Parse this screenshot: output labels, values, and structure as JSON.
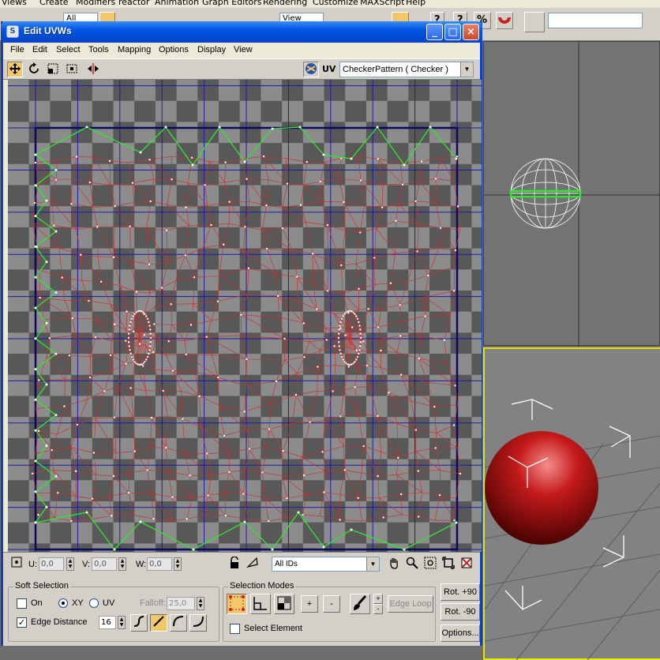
{
  "host": {
    "menu": [
      "Views",
      "Create",
      "Modifiers",
      "reactor",
      "Animation",
      "Graph Editors",
      "Rendering",
      "Customize",
      "MAXScript",
      "Help"
    ],
    "selection_set_value": "All",
    "view_value": "View"
  },
  "window": {
    "title": "Edit UVWs",
    "icon_glyph": "S",
    "controls": [
      "_",
      "□",
      "×"
    ]
  },
  "menubar": [
    "File",
    "Edit",
    "Select",
    "Tools",
    "Mapping",
    "Options",
    "Display",
    "View"
  ],
  "toolbar": {
    "uv_label": "UV",
    "texture_value": "CheckerPattern  ( Checker )"
  },
  "status": {
    "u_label": "U:",
    "u_value": "0,0",
    "v_label": "V:",
    "v_value": "0,0",
    "w_label": "W:",
    "w_value": "0,0",
    "ids_value": "All IDs"
  },
  "soft_selection": {
    "title": "Soft Selection",
    "on_label": "On",
    "xy_label": "XY",
    "uv_label": "UV",
    "falloff_label": "Falloff:",
    "falloff_value": "25,0",
    "edge_distance_label": "Edge Distance",
    "edge_distance_checked": "✓",
    "edge_distance_value": "16"
  },
  "selection_modes": {
    "title": "Selection Modes",
    "plus": "+",
    "minus": "-",
    "edge_loop_label": "Edge Loop",
    "select_element_label": "Select Element"
  },
  "rotate": {
    "rot_plus_label": "Rot. +90",
    "rot_minus_label": "Rot. -90",
    "options_label": "Options..."
  },
  "colors": {
    "grid_line": "#1a1aa8",
    "mesh_edge": "#c8322d",
    "border_edge": "#2ee82e",
    "vertex": "#ffffff",
    "checker_light": "#8c8c8c",
    "checker_dark": "#585858"
  }
}
